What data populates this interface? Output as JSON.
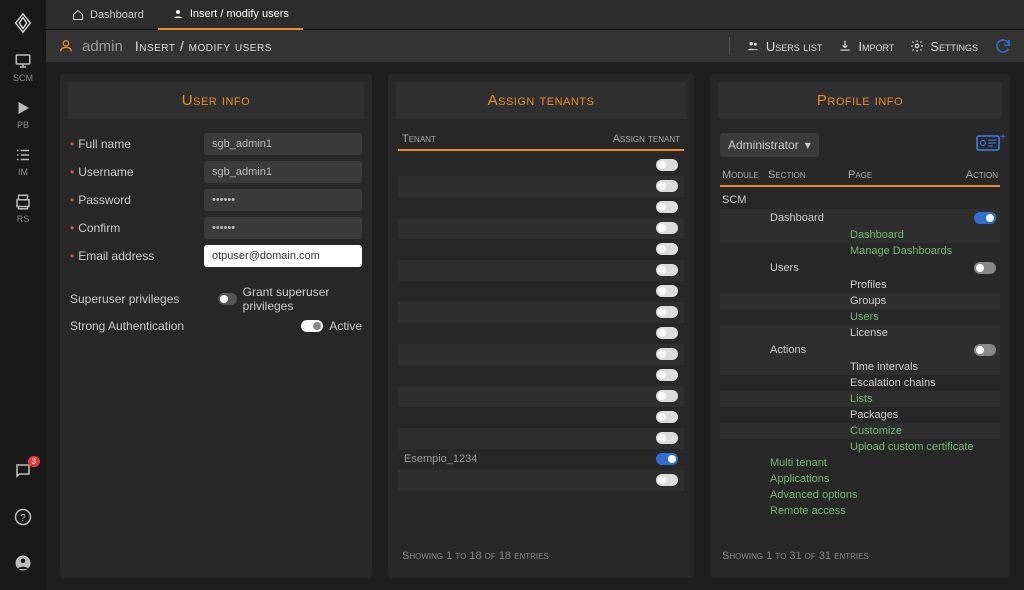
{
  "sidebar": {
    "items": [
      {
        "label": "SCM",
        "icon": "monitor"
      },
      {
        "label": "PB",
        "icon": "play"
      },
      {
        "label": "IM",
        "icon": "list"
      },
      {
        "label": "RS",
        "icon": "print"
      }
    ],
    "chat_badge": "3"
  },
  "tabs": {
    "dashboard": "Dashboard",
    "insert_modify": "Insert / modify users"
  },
  "header": {
    "username": "admin",
    "title": "Insert / modify users",
    "users_list": "Users list",
    "import": "Import",
    "settings": "Settings"
  },
  "user_info": {
    "title": "User info",
    "fields": {
      "full_name_label": "Full name",
      "full_name_value": "sgb_admin1",
      "username_label": "Username",
      "username_value": "sgb_admin1",
      "password_label": "Password",
      "password_value": "••••••",
      "confirm_label": "Confirm",
      "confirm_value": "••••••",
      "email_label": "Email address",
      "email_value": "otpuser@domain.com",
      "superuser_label": "Superuser privileges",
      "superuser_toggle_label": "Grant superuser privileges",
      "strongauth_label": "Strong Authentication",
      "strongauth_toggle_label": "Active"
    }
  },
  "assign_tenants": {
    "title": "Assign tenants",
    "col_tenant": "Tenant",
    "col_assign": "Assign tenant",
    "rows": [
      {
        "name": "",
        "on": false
      },
      {
        "name": "",
        "on": false
      },
      {
        "name": "",
        "on": false
      },
      {
        "name": "",
        "on": false
      },
      {
        "name": "",
        "on": false
      },
      {
        "name": "",
        "on": false
      },
      {
        "name": "",
        "on": false
      },
      {
        "name": "",
        "on": false
      },
      {
        "name": "",
        "on": false
      },
      {
        "name": "",
        "on": false
      },
      {
        "name": "",
        "on": false
      },
      {
        "name": "",
        "on": false
      },
      {
        "name": "",
        "on": false
      },
      {
        "name": "",
        "on": false
      },
      {
        "name": "Esempio_1234",
        "on": true
      },
      {
        "name": "",
        "on": false
      }
    ],
    "footer": "Showing 1 to 18 of 18 entries"
  },
  "profile_info": {
    "title": "Profile info",
    "selector": "Administrator",
    "col_module": "Module",
    "col_section": "Section",
    "col_page": "Page",
    "col_action": "Action",
    "module": "SCM",
    "sections": [
      {
        "name": "Dashboard",
        "toggle": true,
        "pages": [
          {
            "name": "Dashboard",
            "green": true
          },
          {
            "name": "Manage Dashboards",
            "green": true
          }
        ]
      },
      {
        "name": "Users",
        "toggle": false,
        "pages": [
          {
            "name": "Profiles",
            "green": false
          },
          {
            "name": "Groups",
            "green": false
          },
          {
            "name": "Users",
            "green": true
          },
          {
            "name": "License",
            "green": false
          }
        ]
      },
      {
        "name": "Actions",
        "toggle": false,
        "pages": [
          {
            "name": "Time intervals",
            "green": false
          },
          {
            "name": "Escalation chains",
            "green": false
          },
          {
            "name": "Lists",
            "green": true
          },
          {
            "name": "Packages",
            "green": false
          },
          {
            "name": "Customize",
            "green": true
          },
          {
            "name": "Upload custom certificate",
            "green": true
          }
        ]
      }
    ],
    "additional": [
      "Multi tenant",
      "Applications",
      "Advanced options",
      "Remote access"
    ],
    "footer": "Showing 1 to 31 of 31 entries"
  }
}
